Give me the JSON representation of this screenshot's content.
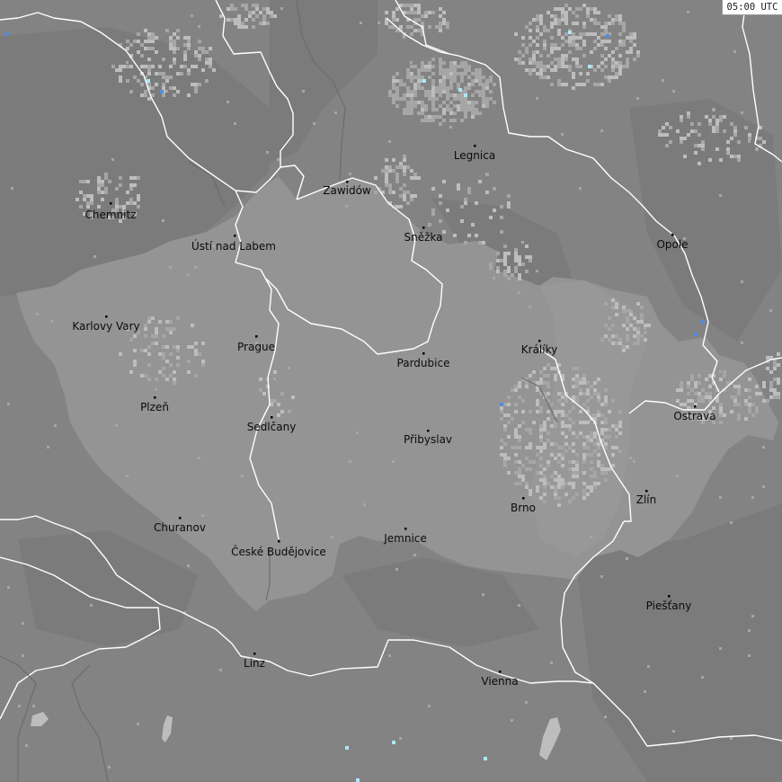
{
  "timestamp": "05:00 UTC",
  "colors": {
    "background": "#838383",
    "region": "#949494",
    "upland": "#7b7b7b",
    "border": "#ffffff",
    "density_low": "#a6a6a6",
    "density_high": "#bdbdbd",
    "strike_blue": "#4f8fe0",
    "strike_cyan": "#a9e8ff"
  },
  "cities": [
    {
      "id": "chemnitz",
      "name": "Chemnitz"
    },
    {
      "id": "usti",
      "name": "Ústí nad Labem"
    },
    {
      "id": "karlovy-vary",
      "name": "Karlovy Vary"
    },
    {
      "id": "prague",
      "name": "Prague"
    },
    {
      "id": "plzen",
      "name": "Plzeň"
    },
    {
      "id": "sedlcany",
      "name": "Sedlčany"
    },
    {
      "id": "churanov",
      "name": "Churanov"
    },
    {
      "id": "ceske-budejovice",
      "name": "České Budějovice"
    },
    {
      "id": "zawidow",
      "name": "Zawidów"
    },
    {
      "id": "legnica",
      "name": "Legnica"
    },
    {
      "id": "snezka",
      "name": "Sněžka"
    },
    {
      "id": "pardubice",
      "name": "Pardubice"
    },
    {
      "id": "pribyslav",
      "name": "Přibyslav"
    },
    {
      "id": "jemnice",
      "name": "Jemnice"
    },
    {
      "id": "kraliky",
      "name": "Králíky"
    },
    {
      "id": "brno",
      "name": "Brno"
    },
    {
      "id": "zlin",
      "name": "Zlín"
    },
    {
      "id": "opole",
      "name": "Opole"
    },
    {
      "id": "ostrava",
      "name": "Ostrava"
    },
    {
      "id": "piestany",
      "name": "Piešťany"
    },
    {
      "id": "linz",
      "name": "Linz"
    },
    {
      "id": "vienna",
      "name": "Vienna"
    }
  ]
}
